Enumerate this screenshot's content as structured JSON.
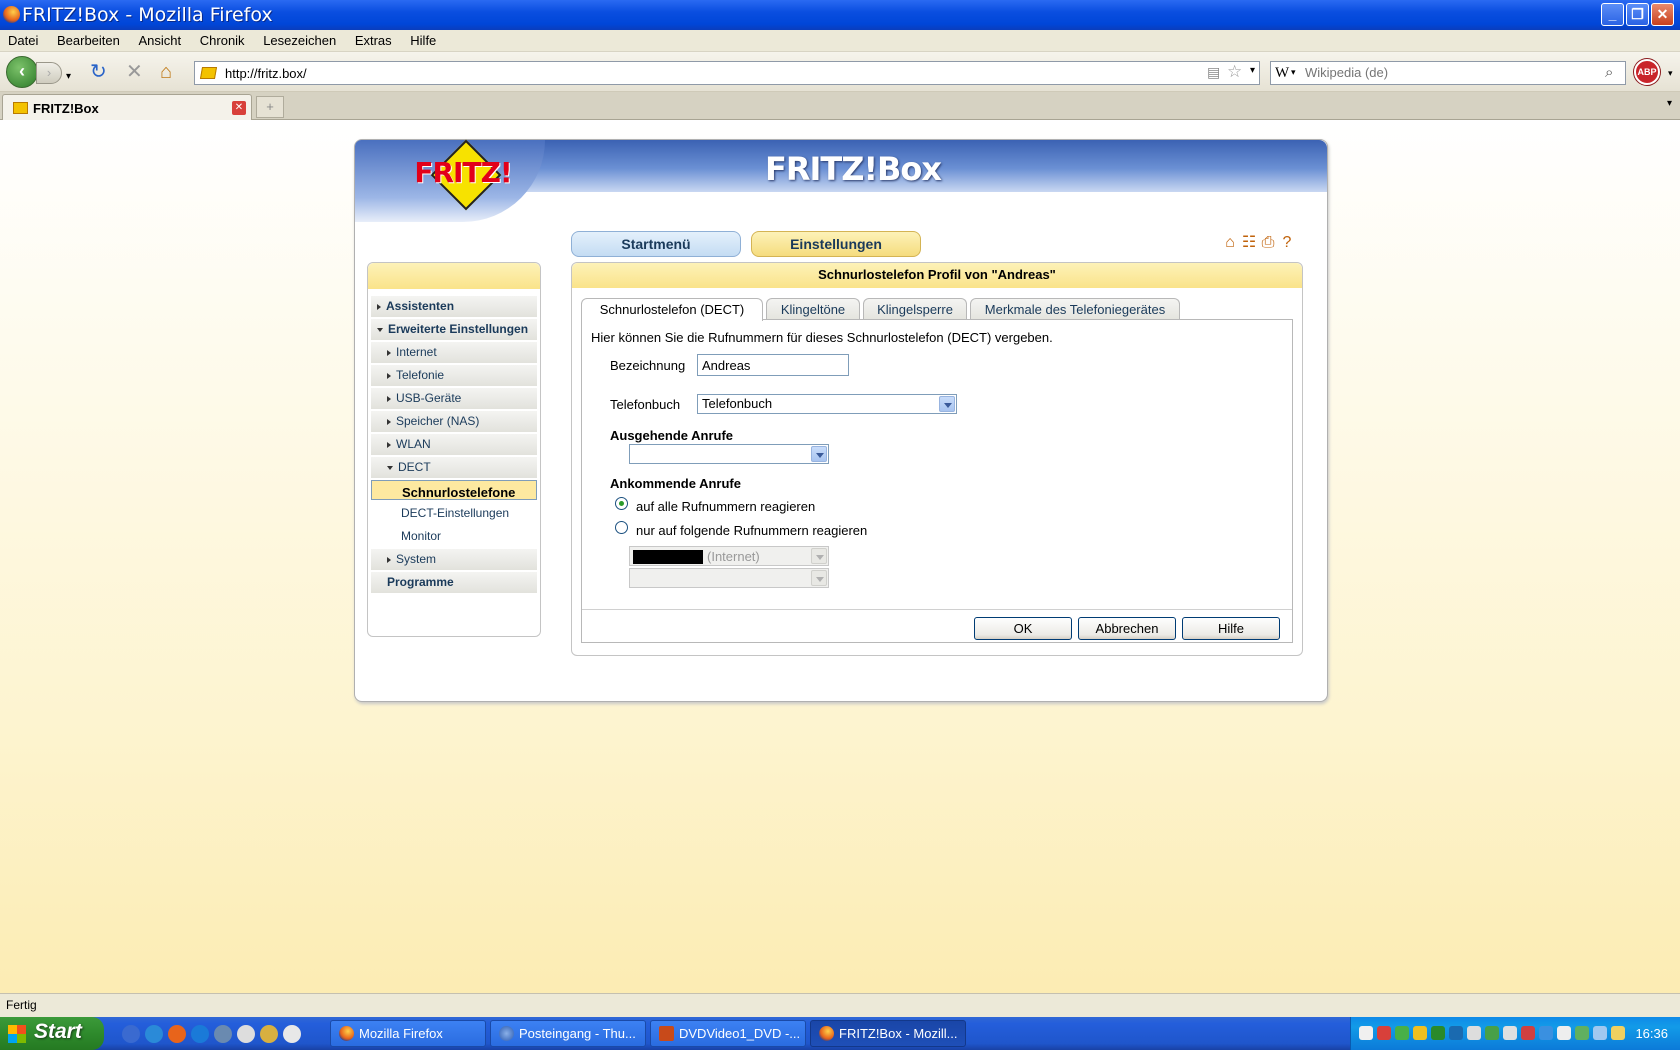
{
  "window": {
    "title": "FRITZ!Box - Mozilla Firefox"
  },
  "menu": [
    "Datei",
    "Bearbeiten",
    "Ansicht",
    "Chronik",
    "Lesezeichen",
    "Extras",
    "Hilfe"
  ],
  "nav": {
    "url": "http://fritz.box/",
    "search_placeholder": "Wikipedia (de)",
    "search_engine": "W",
    "abp": "ABP"
  },
  "tab": {
    "label": "FRITZ!Box",
    "new_tab": "+"
  },
  "fritz": {
    "logo": "FRITZ!",
    "brand": "FRITZ!Box",
    "top_buttons": [
      "Startmenü",
      "Einstellungen"
    ],
    "sidebar": [
      {
        "label": "Assistenten",
        "style": "bold",
        "arrow": "r"
      },
      {
        "label": "Erweiterte Einstellungen",
        "style": "bold",
        "arrow": "d"
      },
      {
        "label": "Internet",
        "arrow": "r"
      },
      {
        "label": "Telefonie",
        "arrow": "r"
      },
      {
        "label": "USB-Geräte",
        "arrow": "r"
      },
      {
        "label": "Speicher (NAS)",
        "arrow": "r"
      },
      {
        "label": "WLAN",
        "arrow": "r"
      },
      {
        "label": "DECT",
        "arrow": "d"
      },
      {
        "label": "Schnurlostelefone",
        "style": "sel"
      },
      {
        "label": "DECT-Einstellungen",
        "style": "plain"
      },
      {
        "label": "Monitor",
        "style": "plain"
      },
      {
        "label": "System",
        "arrow": "r"
      },
      {
        "label": "Programme",
        "style": "bold"
      }
    ],
    "panel_title": "Schnurlostelefon Profil von \"Andreas\"",
    "tabs": [
      "Schnurlostelefon (DECT)",
      "Klingeltöne",
      "Klingelsperre",
      "Merkmale des Telefoniegerätes"
    ],
    "intro": "Hier können Sie die Rufnummern für dieses Schnurlostelefon (DECT) vergeben.",
    "bezeichnung_label": "Bezeichnung",
    "bezeichnung_value": "Andreas",
    "telefonbuch_label": "Telefonbuch",
    "telefonbuch_value": "Telefonbuch",
    "ausgehende_label": "Ausgehende Anrufe",
    "ausgehende_value": "",
    "ankommende_label": "Ankommende Anrufe",
    "radio_all": "auf alle Rufnummern reagieren",
    "radio_some": "nur auf folgende Rufnummern reagieren",
    "number1_suffix": "(Internet)",
    "buttons": [
      "OK",
      "Abbrechen",
      "Hilfe"
    ]
  },
  "status": "Fertig",
  "taskbar": {
    "start": "Start",
    "tasks": [
      "Mozilla Firefox",
      "Posteingang - Thu...",
      "DVDVideo1_DVD -...",
      "FRITZ!Box - Mozill..."
    ],
    "clock": "16:36"
  }
}
